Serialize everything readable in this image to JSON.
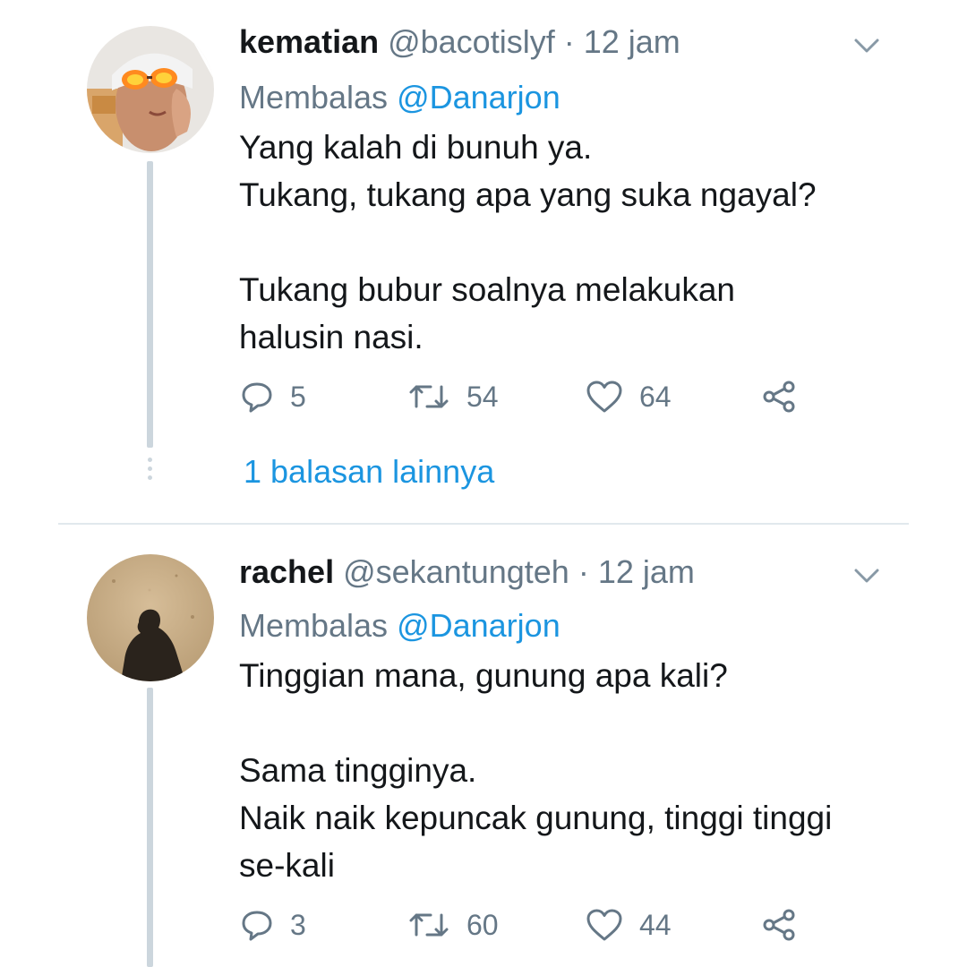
{
  "tweets": [
    {
      "name": "kematian",
      "handle": "@bacotislyf",
      "separator": "·",
      "time": "12 jam",
      "reply_prefix": "Membalas",
      "reply_mention": "@Danarjon",
      "lines": [
        "Yang kalah di bunuh ya.",
        "Tukang, tukang apa yang suka ngayal?",
        "",
        "Tukang bubur soalnya melakukan",
        "halusin nasi."
      ],
      "replies": "5",
      "retweets": "54",
      "likes": "64",
      "more_replies": "1 balasan lainnya",
      "avatar_icon": "avatar-sunglasses-selfie"
    },
    {
      "name": "rachel",
      "handle": "@sekantungteh",
      "separator": "·",
      "time": "12 jam",
      "reply_prefix": "Membalas",
      "reply_mention": "@Danarjon",
      "lines": [
        "Tinggian mana, gunung apa kali?",
        "",
        "Sama tingginya.",
        "Naik naik kepuncak gunung, tinggi tinggi",
        "se-kali"
      ],
      "replies": "3",
      "retweets": "60",
      "likes": "44",
      "avatar_icon": "avatar-shadow-on-sand"
    }
  ],
  "colors": {
    "text": "#14171a",
    "secondary": "#657786",
    "link": "#1b95e0",
    "thread_line": "#ccd6dd",
    "divider": "#e1e8ed"
  },
  "icons": [
    "reply-icon",
    "retweet-icon",
    "like-icon",
    "share-icon",
    "chevron-down-icon"
  ]
}
